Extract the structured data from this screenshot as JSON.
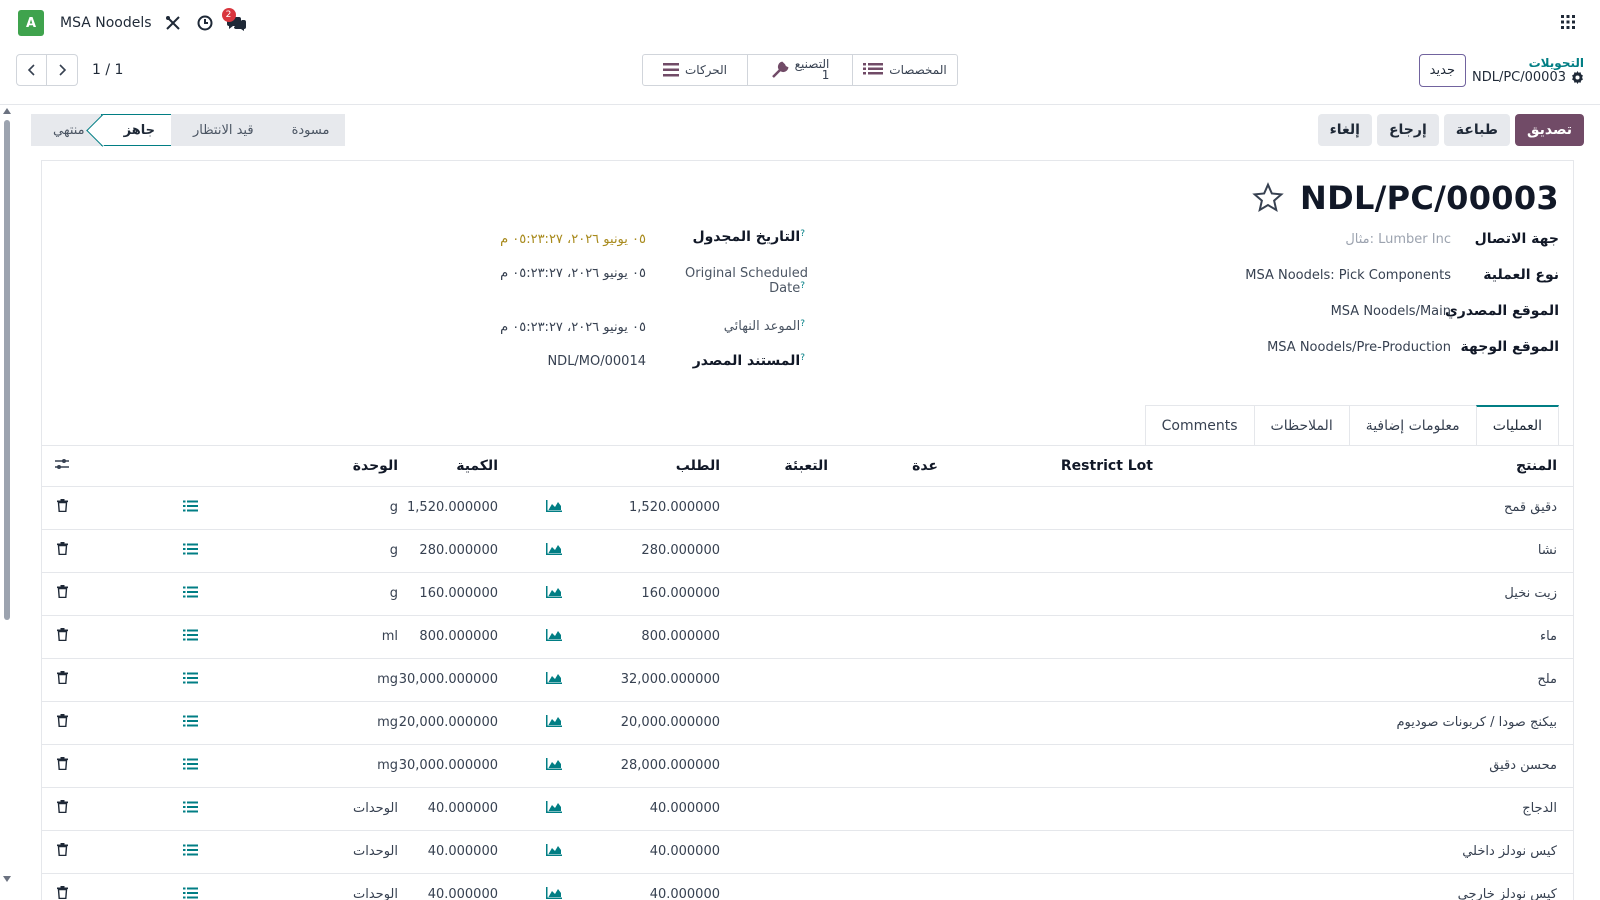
{
  "navbar": {
    "avatar_letter": "A",
    "company": "MSA Noodels",
    "messages_count": "2"
  },
  "pager": {
    "value": "1 / 1"
  },
  "smart_buttons": {
    "allocations": "المخصصات",
    "manufacturing": "التصنيع",
    "manufacturing_count": "1",
    "moves": "الحركات"
  },
  "breadcrumb": {
    "new_label": "جديد",
    "parent": "التحويلات",
    "current": "NDL/PC/00003"
  },
  "actions": {
    "validate": "تصديق",
    "print": "طباعة",
    "return": "إرجاع",
    "cancel": "إلغاء"
  },
  "statusbar": {
    "stages": [
      "مسودة",
      "قيد الانتظار",
      "جاهز",
      "منتهي"
    ],
    "active": "جاهز"
  },
  "record": {
    "title": "NDL/PC/00003"
  },
  "fields_right": {
    "contact_label": "جهة الاتصال",
    "contact_placeholder": "مثال: Lumber Inc",
    "operation_type_label": "نوع العملية",
    "operation_type": "MSA Noodels: Pick Components",
    "source_location_label": "الموقع المصدري",
    "source_location": "MSA Noodels/Main",
    "dest_location_label": "الموقع الوجهة",
    "dest_location": "MSA Noodels/Pre-Production"
  },
  "fields_left": {
    "scheduled_date_label": "التاريخ المجدول",
    "scheduled_date": "٠٥ يونيو ٢٠٢٦، ٠٥:٢٣:٢٧ م",
    "original_scheduled_label_1": "Original Scheduled",
    "original_scheduled_label_2": "Date",
    "original_scheduled": "٠٥ يونيو ٢٠٢٦، ٠٥:٢٣:٢٧ م",
    "deadline_label": "الموعد النهائي",
    "deadline": "٠٥ يونيو ٢٠٢٦، ٠٥:٢٣:٢٧ م",
    "source_doc_label": "المستند المصدر",
    "source_doc": "NDL/MO/00014"
  },
  "tabs": [
    "العمليات",
    "معلومات إضافية",
    "الملاحظات",
    "Comments"
  ],
  "table": {
    "headers": {
      "product": "المنتج",
      "restrict_lot": "Restrict Lot",
      "count": "عدة",
      "packaging": "التعبئة",
      "demand": "الطلب",
      "quantity": "الكمية",
      "uom": "الوحدة"
    },
    "rows": [
      {
        "product": "دقيق قمح",
        "demand": "1,520.000000",
        "quantity": "1,520.000000",
        "uom": "g",
        "shortage": false
      },
      {
        "product": "نشا",
        "demand": "280.000000",
        "quantity": "280.000000",
        "uom": "g",
        "shortage": false
      },
      {
        "product": "زيت نخيل",
        "demand": "160.000000",
        "quantity": "160.000000",
        "uom": "g",
        "shortage": false
      },
      {
        "product": "ماء",
        "demand": "800.000000",
        "quantity": "800.000000",
        "uom": "ml",
        "shortage": false
      },
      {
        "product": "ملح",
        "demand": "32,000.000000",
        "quantity": "30,000.000000",
        "uom": "mg",
        "shortage": false
      },
      {
        "product": "بيكنج صودا / كربونات صوديوم",
        "demand": "20,000.000000",
        "quantity": "20,000.000000",
        "uom": "mg",
        "shortage": false
      },
      {
        "product": "محسن دقيق",
        "demand": "28,000.000000",
        "quantity": "30,000.000000",
        "uom": "mg",
        "shortage": true
      },
      {
        "product": "الدجاج",
        "demand": "40.000000",
        "quantity": "40.000000",
        "uom": "الوحدات",
        "shortage": false
      },
      {
        "product": "كيس نودلز داخلي",
        "demand": "40.000000",
        "quantity": "40.000000",
        "uom": "الوحدات",
        "shortage": false
      },
      {
        "product": "كيس نودلز خارجي",
        "demand": "40.000000",
        "quantity": "40.000000",
        "uom": "الوحدات",
        "shortage": false
      }
    ]
  },
  "colors": {
    "primary": "#714b67",
    "teal": "#017e84",
    "danger": "#d9363e",
    "avatar": "#3fa34d"
  }
}
